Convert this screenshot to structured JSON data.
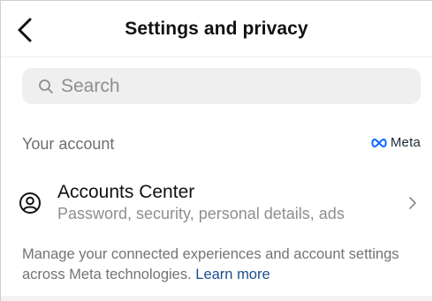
{
  "header": {
    "title": "Settings and privacy",
    "back_icon": "chevron-left-icon"
  },
  "search": {
    "placeholder": "Search",
    "icon": "search-icon"
  },
  "your_account": {
    "section_title": "Your account",
    "brand": "Meta",
    "brand_icon": "meta-infinity-icon",
    "accounts_center": {
      "title": "Accounts Center",
      "subtitle": "Password, security, personal details, ads",
      "icon": "user-circle-icon",
      "chevron_icon": "chevron-right-icon"
    },
    "description": "Manage your connected experiences and account settings across Meta technologies.",
    "learn_more": "Learn more"
  },
  "colors": {
    "text_primary": "#111111",
    "text_secondary": "#737373",
    "link": "#1b4f8c",
    "search_bg": "#efefef"
  }
}
